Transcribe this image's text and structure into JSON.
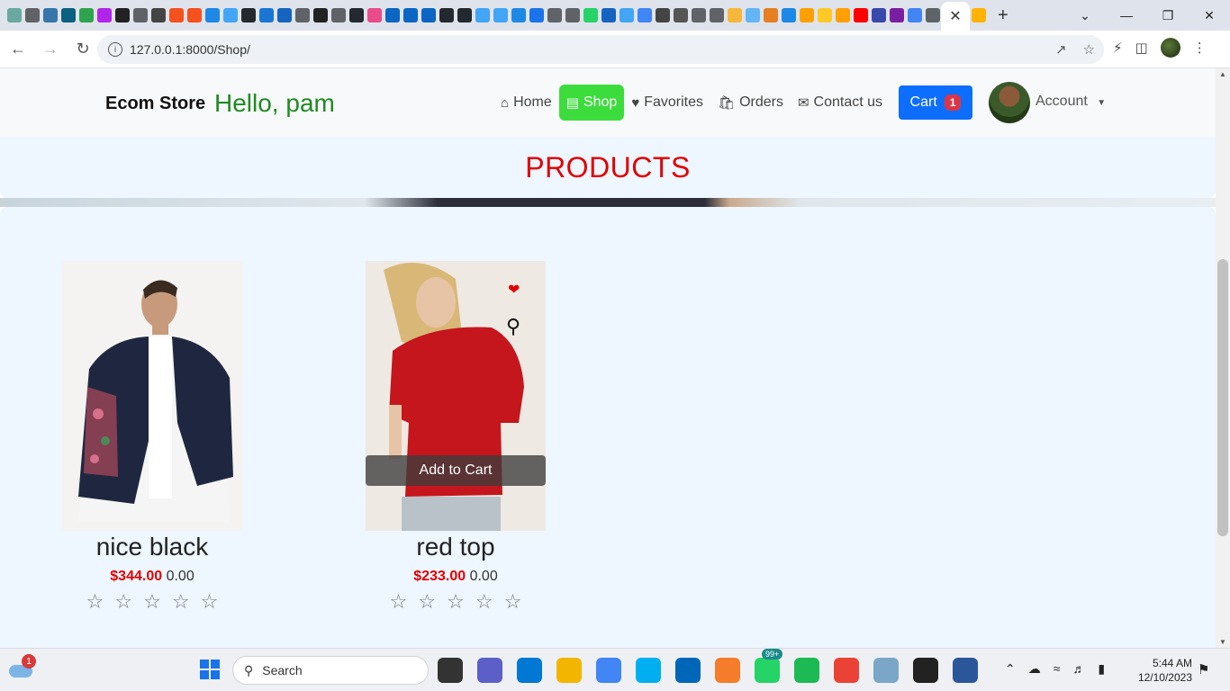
{
  "browser": {
    "url": "127.0.0.1:8000/Shop/",
    "new_tab_symbol": "+",
    "close_tab_symbol": "✕",
    "window_controls": [
      "⌄",
      "—",
      "❐",
      "✕"
    ]
  },
  "nav": {
    "brand": "Ecom Store",
    "greeting": "Hello, pam",
    "links": [
      {
        "label": "Home",
        "icon": "home-icon"
      },
      {
        "label": "Shop",
        "icon": "store-icon",
        "active": true
      },
      {
        "label": "Favorites",
        "icon": "heart-icon"
      },
      {
        "label": "Orders",
        "icon": "bag-icon"
      },
      {
        "label": "Contact us",
        "icon": "envelope-icon"
      }
    ],
    "cart_label": "Cart",
    "cart_count": "1",
    "account_label": "Account"
  },
  "page": {
    "heading": "PRODUCTS"
  },
  "products": [
    {
      "name": "nice black",
      "price": "$344.00",
      "rating_value": "0.00",
      "stars": 5
    },
    {
      "name": "red top",
      "price": "$233.00",
      "rating_value": "0.00",
      "stars": 5,
      "overlay_button": "Add to Cart"
    }
  ],
  "taskbar": {
    "weather_badge": "1",
    "search_placeholder": "Search",
    "whatsapp_badge": "99+",
    "time": "5:44 AM",
    "date": "12/10/2023"
  },
  "colors": {
    "brand_greeting": "#1f8a23",
    "active_nav": "#3ddc3d",
    "cart_button": "#0d6efd",
    "badge": "#dc3545",
    "heading": "#e00000",
    "price": "#e00000",
    "page_bg": "#eef6ff"
  }
}
